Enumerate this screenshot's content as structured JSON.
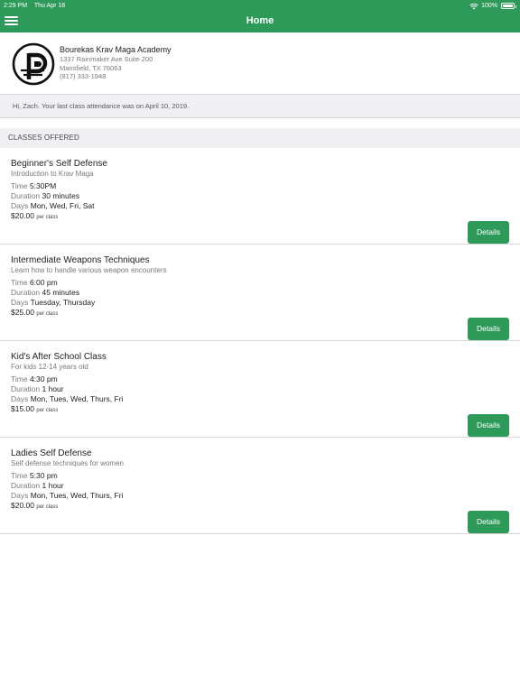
{
  "status_bar": {
    "time": "2:29 PM",
    "date": "Thu Apr 18",
    "battery": "100%",
    "icons": [
      "wifi-icon",
      "battery-icon"
    ]
  },
  "header": {
    "title": "Home",
    "menu_icon": "hamburger-menu-icon",
    "color": "#2e9a5a"
  },
  "academy": {
    "name": "Bourekas Krav Maga Academy",
    "address": "1337 Rainmaker Ave Suite 200",
    "city": "Mansfield, TX 76063",
    "phone": "(817) 333-1948",
    "logo_icon": "academy-logo-icon"
  },
  "greeting": "Hi, Zach. Your last class attendance was on April 10, 2019.",
  "section_title": "CLASSES OFFERED",
  "labels": {
    "time": "Time",
    "duration": "Duration",
    "days": "Days",
    "per_class": "per class",
    "details": "Details"
  },
  "classes": [
    {
      "name": "Beginner's Self Defense",
      "description": "Introduction to Krav Maga",
      "time": "5:30PM",
      "duration": "30 minutes",
      "days": "Mon, Wed, Fri, Sat",
      "price": "$20.00"
    },
    {
      "name": "Intermediate Weapons Techniques",
      "description": "Learn how to handle various weapon encounters",
      "time": "6:00 pm",
      "duration": "45 minutes",
      "days": "Tuesday, Thursday",
      "price": "$25.00"
    },
    {
      "name": "Kid's After School Class",
      "description": "For kids 12-14 years old",
      "time": "4:30 pm",
      "duration": "1 hour",
      "days": "Mon, Tues, Wed, Thurs, Fri",
      "price": "$15.00"
    },
    {
      "name": "Ladies Self Defense",
      "description": "Self defense techniques for women",
      "time": "5:30 pm",
      "duration": "1 hour",
      "days": "Mon, Tues, Wed, Thurs, Fri",
      "price": "$20.00"
    }
  ]
}
